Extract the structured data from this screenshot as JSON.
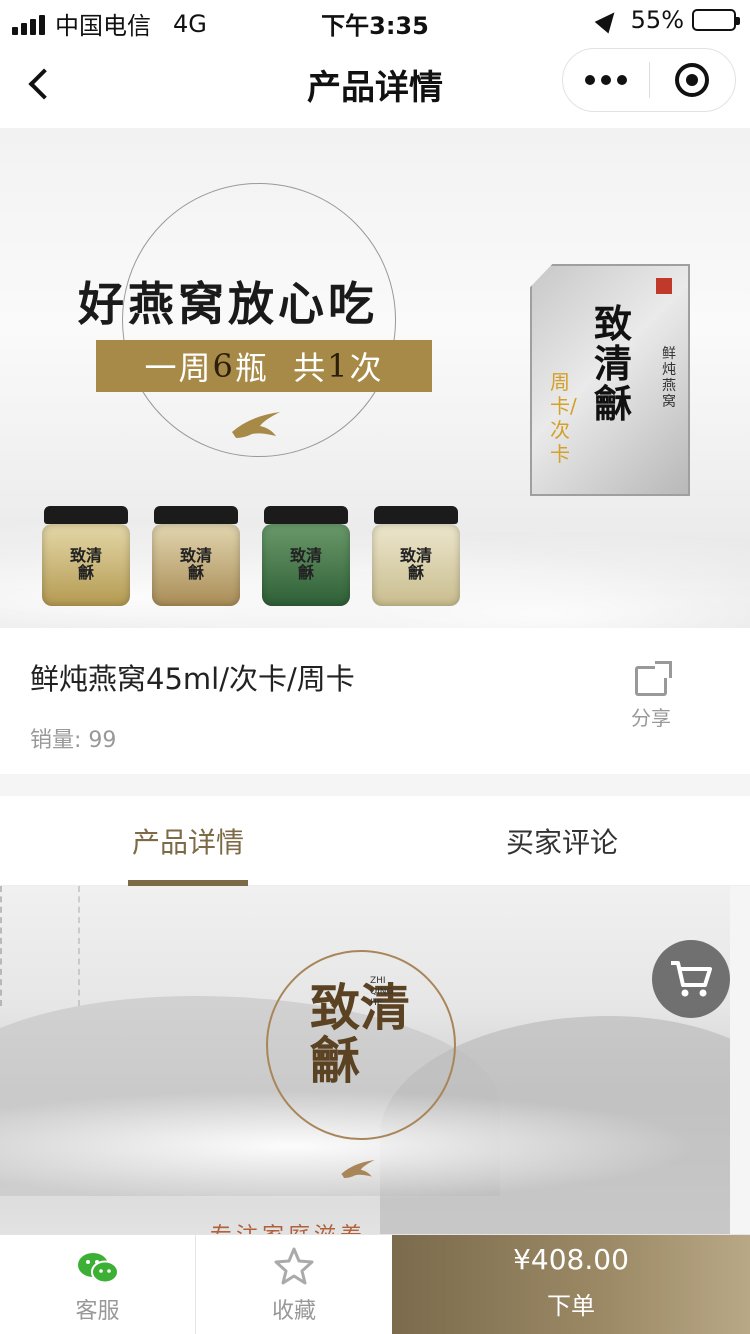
{
  "status_bar": {
    "carrier": "中国电信",
    "network": "4G",
    "time": "下午3:35",
    "battery": "55%",
    "battery_level": 0.55
  },
  "nav": {
    "title": "产品详情",
    "back_icon": "chevron-left-icon",
    "more_icon": "more-dots-icon",
    "close_icon": "target-close-icon"
  },
  "banner": {
    "slogan": "好燕窝放心吃",
    "offer_pre": "一周",
    "offer_num": "6",
    "offer_mid": "瓶  共",
    "offer_num2": "1",
    "offer_post": "次",
    "card_brand": "致清龢",
    "card_product": "鲜炖燕窝",
    "card_kind": "周卡/次卡",
    "jar_label": "致清龢"
  },
  "product": {
    "name": "鲜炖燕窝45ml/次卡/周卡",
    "sales_label": "销量:",
    "sales_value": "99",
    "share_label": "分享",
    "share_icon": "share-icon"
  },
  "tabs": {
    "items": [
      {
        "label": "产品详情",
        "active": true
      },
      {
        "label": "买家评论",
        "active": false
      }
    ],
    "accent": "#7d6a47"
  },
  "detail": {
    "logo_text": "致清龢",
    "logo_sub": "ZHI QING HE",
    "slogan": "专注家庭滋养"
  },
  "cart": {
    "icon": "cart-icon"
  },
  "bottom_bar": {
    "service_label": "客服",
    "service_icon": "wechat-icon",
    "favorite_label": "收藏",
    "favorite_icon": "star-icon",
    "price": "¥408.00",
    "order_label": "下单"
  }
}
